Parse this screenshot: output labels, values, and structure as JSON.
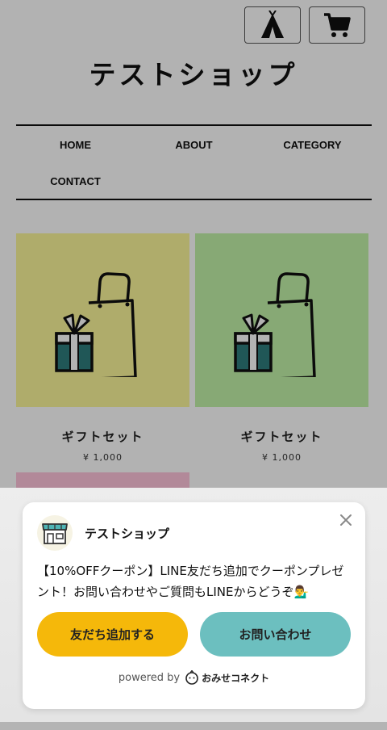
{
  "header": {
    "shop_title": "テストショップ",
    "icons": [
      "tent-icon",
      "cart-icon"
    ]
  },
  "nav": {
    "items": [
      {
        "label": "HOME"
      },
      {
        "label": "ABOUT"
      },
      {
        "label": "CATEGORY"
      },
      {
        "label": "CONTACT"
      }
    ]
  },
  "products": [
    {
      "name": "ギフトセット",
      "price": "¥ 1,000",
      "bg_color": "#fbf69a"
    },
    {
      "name": "ギフトセット",
      "price": "¥ 1,000",
      "bg_color": "#c2f3a8"
    }
  ],
  "popup": {
    "shop_name": "テストショップ",
    "message": "【10%OFFクーポン】LINE友だち追加でクーポンプレゼント！お問い合わせやご質問もLINEからどうぞ💁‍♂️",
    "add_friend_label": "友だち追加する",
    "contact_label": "お問い合わせ",
    "powered_by": "powered by",
    "brand": "おみせコネクト",
    "colors": {
      "add_friend": "#f5b80a",
      "contact": "#6cbfbf"
    }
  }
}
